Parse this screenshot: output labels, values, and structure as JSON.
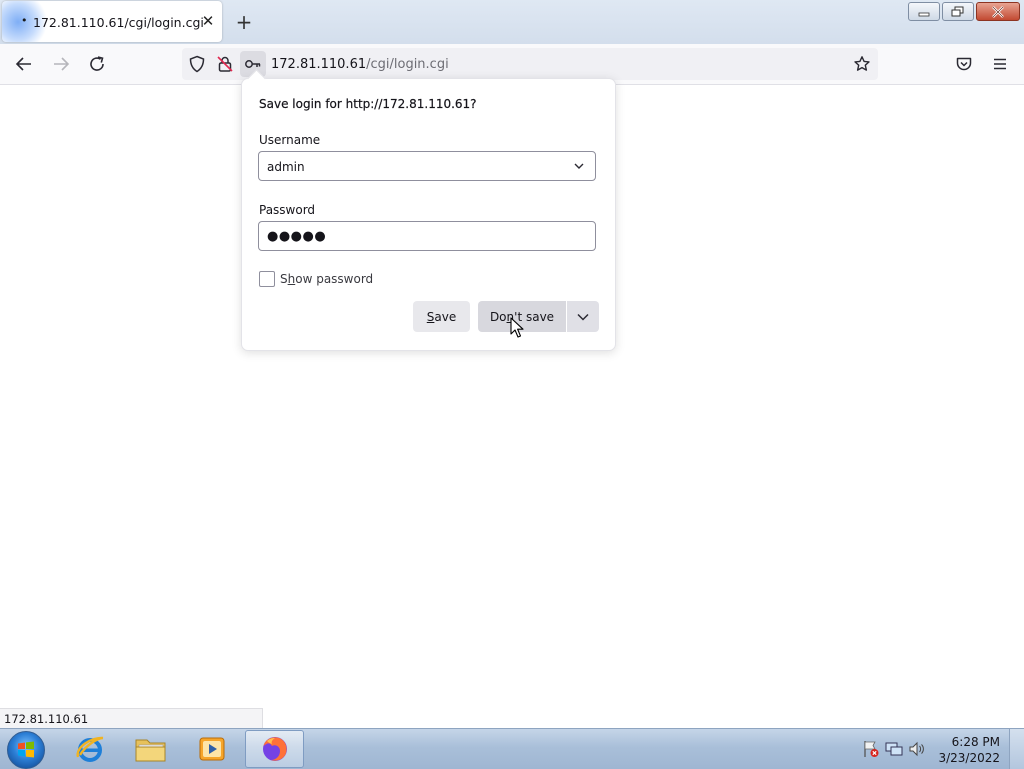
{
  "browser": {
    "tab": {
      "dot": "•",
      "title": "172.81.110.61/cgi/login.cgi"
    },
    "new_tab_symbol": "+",
    "close_symbol": "✕"
  },
  "address_bar": {
    "host": "172.81.110.61",
    "path": "/cgi/login.cgi"
  },
  "popup": {
    "title": "Save login for http://172.81.110.61?",
    "username_label": "Username",
    "username_value": "admin",
    "password_label": "Password",
    "password_masked": "●●●●●",
    "show_password_label_first": "S",
    "show_password_label_u": "h",
    "show_password_label_rest": "ow password",
    "show_password_checked": false,
    "save_u": "S",
    "save_rest": "ave",
    "dont_save_pre": "Do",
    "dont_save_u": "n",
    "dont_save_rest": "'t save"
  },
  "status_bar": {
    "text": "172.81.110.61"
  },
  "taskbar": {
    "apps": [
      {
        "name": "internet-explorer"
      },
      {
        "name": "file-explorer"
      },
      {
        "name": "media-player"
      },
      {
        "name": "firefox",
        "active": true
      }
    ],
    "clock": {
      "time": "6:28 PM",
      "date": "3/23/2022"
    }
  },
  "colors": {
    "accent": "#0060df",
    "taskbar": "#a9bfd9",
    "popup_button": "#e8e8ec"
  }
}
